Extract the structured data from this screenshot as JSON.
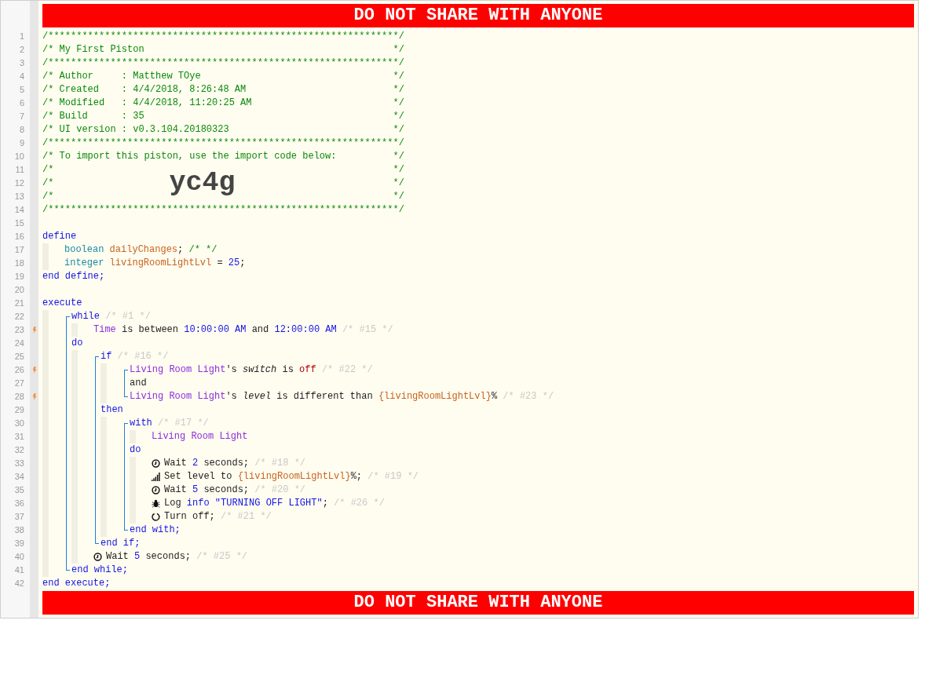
{
  "top_banner": "DO NOT SHARE WITH ANYONE",
  "code": [
    {
      "kind": "line",
      "number": "1",
      "bolt": false,
      "tokens": [
        {
          "kind": "comment",
          "text": "/**************************************************************/"
        }
      ]
    },
    {
      "kind": "line",
      "number": "2",
      "bolt": false,
      "box": {
        "text": "/* My First Piston",
        "end": "*/"
      }
    },
    {
      "kind": "line",
      "number": "3",
      "bolt": false,
      "tokens": [
        {
          "kind": "comment",
          "text": "/**************************************************************/"
        }
      ]
    },
    {
      "kind": "line",
      "number": "4",
      "bolt": false,
      "box": {
        "text": "/* Author     : Matthew TOye",
        "end": "*/"
      }
    },
    {
      "kind": "line",
      "number": "5",
      "bolt": false,
      "box": {
        "text": "/* Created    : 4/4/2018, 8:26:48 AM",
        "end": "*/"
      }
    },
    {
      "kind": "line",
      "number": "6",
      "bolt": false,
      "box": {
        "text": "/* Modified   : 4/4/2018, 11:20:25 AM",
        "end": "*/"
      }
    },
    {
      "kind": "line",
      "number": "7",
      "bolt": false,
      "box": {
        "text": "/* Build      : 35",
        "end": "*/"
      }
    },
    {
      "kind": "line",
      "number": "8",
      "bolt": false,
      "box": {
        "text": "/* UI version : v0.3.104.20180323",
        "end": "*/"
      }
    },
    {
      "kind": "line",
      "number": "9",
      "bolt": false,
      "tokens": [
        {
          "kind": "comment",
          "text": "/**************************************************************/"
        }
      ]
    },
    {
      "kind": "line",
      "number": "10",
      "bolt": false,
      "box": {
        "text": "/* To import this piston, use the import code below:",
        "end": "*/"
      }
    },
    {
      "kind": "line",
      "number": "11",
      "bolt": false,
      "box": {
        "text": "/*",
        "end": "*/"
      }
    },
    {
      "kind": "line",
      "number": "12",
      "bolt": false,
      "box": {
        "text": "/*",
        "code": "yc4g",
        "end": "*/"
      }
    },
    {
      "kind": "line",
      "number": "13",
      "bolt": false,
      "box": {
        "text": "/*",
        "end": "*/"
      }
    },
    {
      "kind": "line",
      "number": "14",
      "bolt": false,
      "tokens": [
        {
          "kind": "comment",
          "text": "/**************************************************************/"
        }
      ]
    },
    {
      "kind": "line",
      "number": "15",
      "bolt": false
    },
    {
      "kind": "line",
      "number": "16",
      "bolt": false,
      "tokens": [
        {
          "kind": "keyword",
          "text": "define"
        }
      ]
    },
    {
      "kind": "indent",
      "children": [
        {
          "kind": "line",
          "number": "17",
          "bolt": false,
          "tokens": [
            {
              "kind": "type",
              "text": "boolean"
            },
            {
              "kind": "var",
              "text": " dailyChanges"
            },
            {
              "kind": "text",
              "text": ";"
            },
            {
              "kind": "comment",
              "text": " /* */"
            }
          ]
        },
        {
          "kind": "line",
          "number": "18",
          "bolt": false,
          "tokens": [
            {
              "kind": "type",
              "text": "integer"
            },
            {
              "kind": "var",
              "text": " livingRoomLightLvl"
            },
            {
              "kind": "text",
              "text": " = "
            },
            {
              "kind": "number",
              "text": "25"
            },
            {
              "kind": "text",
              "text": ";"
            }
          ]
        }
      ]
    },
    {
      "kind": "line",
      "number": "19",
      "bolt": false,
      "tokens": [
        {
          "kind": "keyword",
          "text": "end define;"
        }
      ]
    },
    {
      "kind": "line",
      "number": "20",
      "bolt": false
    },
    {
      "kind": "line",
      "number": "21",
      "bolt": false,
      "tokens": [
        {
          "kind": "keyword",
          "text": "execute"
        }
      ]
    },
    {
      "kind": "indent",
      "children": [
        {
          "kind": "block",
          "children": [
            {
              "kind": "line",
              "number": "22",
              "bolt": false,
              "tokens": [
                {
                  "kind": "keyword",
                  "text": "while"
                },
                {
                  "kind": "faded",
                  "text": " /* #1 */"
                }
              ]
            },
            {
              "kind": "indent",
              "children": [
                {
                  "kind": "line",
                  "number": "23",
                  "bolt": true,
                  "tokens": [
                    {
                      "kind": "device",
                      "text": "Time"
                    },
                    {
                      "kind": "text",
                      "text": " is between "
                    },
                    {
                      "kind": "number",
                      "text": "10:00:00 AM"
                    },
                    {
                      "kind": "text",
                      "text": " and "
                    },
                    {
                      "kind": "number",
                      "text": "12:00:00 AM"
                    },
                    {
                      "kind": "faded",
                      "text": " /* #15 */"
                    }
                  ]
                }
              ]
            },
            {
              "kind": "line",
              "number": "24",
              "bolt": false,
              "tokens": [
                {
                  "kind": "keyword",
                  "text": "do"
                }
              ]
            },
            {
              "kind": "indent",
              "children": [
                {
                  "kind": "block",
                  "children": [
                    {
                      "kind": "line",
                      "number": "25",
                      "bolt": false,
                      "tokens": [
                        {
                          "kind": "keyword",
                          "text": "if"
                        },
                        {
                          "kind": "faded",
                          "text": " /* #16 */"
                        }
                      ]
                    },
                    {
                      "kind": "indent",
                      "children": [
                        {
                          "kind": "block",
                          "children": [
                            {
                              "kind": "line",
                              "number": "26",
                              "bolt": true,
                              "tokens": [
                                {
                                  "kind": "device",
                                  "text": "Living Room Light"
                                },
                                {
                                  "kind": "text",
                                  "text": "'s "
                                },
                                {
                                  "kind": "italic",
                                  "text": "switch"
                                },
                                {
                                  "kind": "text",
                                  "text": " is "
                                },
                                {
                                  "kind": "state",
                                  "text": "off"
                                },
                                {
                                  "kind": "faded",
                                  "text": " /* #22 */"
                                }
                              ]
                            },
                            {
                              "kind": "line",
                              "number": "27",
                              "bolt": false,
                              "tokens": [
                                {
                                  "kind": "text",
                                  "text": "and"
                                }
                              ]
                            },
                            {
                              "kind": "line",
                              "number": "28",
                              "bolt": true,
                              "tokens": [
                                {
                                  "kind": "device",
                                  "text": "Living Room Light"
                                },
                                {
                                  "kind": "text",
                                  "text": "'s "
                                },
                                {
                                  "kind": "italic",
                                  "text": "level"
                                },
                                {
                                  "kind": "text",
                                  "text": " is different than "
                                },
                                {
                                  "kind": "var",
                                  "text": "{livingRoomLightLvl}"
                                },
                                {
                                  "kind": "text",
                                  "text": "%"
                                },
                                {
                                  "kind": "faded",
                                  "text": " /* #23 */"
                                }
                              ]
                            }
                          ]
                        }
                      ]
                    },
                    {
                      "kind": "line",
                      "number": "29",
                      "bolt": false,
                      "tokens": [
                        {
                          "kind": "keyword",
                          "text": "then"
                        }
                      ]
                    },
                    {
                      "kind": "indent",
                      "children": [
                        {
                          "kind": "block",
                          "children": [
                            {
                              "kind": "line",
                              "number": "30",
                              "bolt": false,
                              "tokens": [
                                {
                                  "kind": "keyword",
                                  "text": "with"
                                },
                                {
                                  "kind": "faded",
                                  "text": " /* #17 */"
                                }
                              ]
                            },
                            {
                              "kind": "indent",
                              "children": [
                                {
                                  "kind": "line",
                                  "number": "31",
                                  "bolt": false,
                                  "tokens": [
                                    {
                                      "kind": "device",
                                      "text": "Living Room Light"
                                    }
                                  ]
                                }
                              ]
                            },
                            {
                              "kind": "line",
                              "number": "32",
                              "bolt": false,
                              "tokens": [
                                {
                                  "kind": "keyword",
                                  "text": "do"
                                }
                              ]
                            },
                            {
                              "kind": "indent",
                              "children": [
                                {
                                  "kind": "wait",
                                  "number": "33",
                                  "bolt": false,
                                  "tokens": [
                                    {
                                      "kind": "text",
                                      "text": "Wait "
                                    },
                                    {
                                      "kind": "number",
                                      "text": "2"
                                    },
                                    {
                                      "kind": "text",
                                      "text": " seconds;"
                                    },
                                    {
                                      "kind": "faded",
                                      "text": " /* #18 */"
                                    }
                                  ]
                                },
                                {
                                  "kind": "set-level",
                                  "number": "34",
                                  "bolt": false,
                                  "tokens": [
                                    {
                                      "kind": "text",
                                      "text": "Set level to "
                                    },
                                    {
                                      "kind": "var",
                                      "text": "{livingRoomLightLvl}"
                                    },
                                    {
                                      "kind": "text",
                                      "text": "%;"
                                    },
                                    {
                                      "kind": "faded",
                                      "text": " /* #19 */"
                                    }
                                  ]
                                },
                                {
                                  "kind": "wait",
                                  "number": "35",
                                  "bolt": false,
                                  "tokens": [
                                    {
                                      "kind": "text",
                                      "text": "Wait "
                                    },
                                    {
                                      "kind": "number",
                                      "text": "5"
                                    },
                                    {
                                      "kind": "text",
                                      "text": " seconds;"
                                    },
                                    {
                                      "kind": "faded",
                                      "text": " /* #20 */"
                                    }
                                  ]
                                },
                                {
                                  "kind": "log",
                                  "number": "36",
                                  "bolt": false,
                                  "tokens": [
                                    {
                                      "kind": "text",
                                      "text": "Log "
                                    },
                                    {
                                      "kind": "keyword",
                                      "text": "info"
                                    },
                                    {
                                      "kind": "number",
                                      "text": " \"TURNING OFF LIGHT\""
                                    },
                                    {
                                      "kind": "text",
                                      "text": ";"
                                    },
                                    {
                                      "kind": "faded",
                                      "text": " /* #26 */"
                                    }
                                  ]
                                },
                                {
                                  "kind": "turn-off",
                                  "number": "37",
                                  "bolt": false,
                                  "tokens": [
                                    {
                                      "kind": "text",
                                      "text": "Turn off;"
                                    },
                                    {
                                      "kind": "faded",
                                      "text": " /* #21 */"
                                    }
                                  ]
                                }
                              ]
                            },
                            {
                              "kind": "line",
                              "number": "38",
                              "bolt": false,
                              "tokens": [
                                {
                                  "kind": "keyword",
                                  "text": "end with;"
                                }
                              ]
                            }
                          ]
                        }
                      ]
                    },
                    {
                      "kind": "line",
                      "number": "39",
                      "bolt": false,
                      "tokens": [
                        {
                          "kind": "keyword",
                          "text": "end if;"
                        }
                      ]
                    }
                  ]
                },
                {
                  "kind": "wait",
                  "number": "40",
                  "bolt": false,
                  "tokens": [
                    {
                      "kind": "text",
                      "text": "Wait "
                    },
                    {
                      "kind": "number",
                      "text": "5"
                    },
                    {
                      "kind": "text",
                      "text": " seconds;"
                    },
                    {
                      "kind": "faded",
                      "text": " /* #25 */"
                    }
                  ]
                }
              ]
            },
            {
              "kind": "line",
              "number": "41",
              "bolt": false,
              "tokens": [
                {
                  "kind": "keyword",
                  "text": "end while;"
                }
              ]
            }
          ]
        }
      ]
    },
    {
      "kind": "line",
      "number": "42",
      "bolt": false,
      "tokens": [
        {
          "kind": "keyword",
          "text": "end execute;"
        }
      ]
    }
  ],
  "bottom_banner": "DO NOT SHARE WITH ANYONE"
}
